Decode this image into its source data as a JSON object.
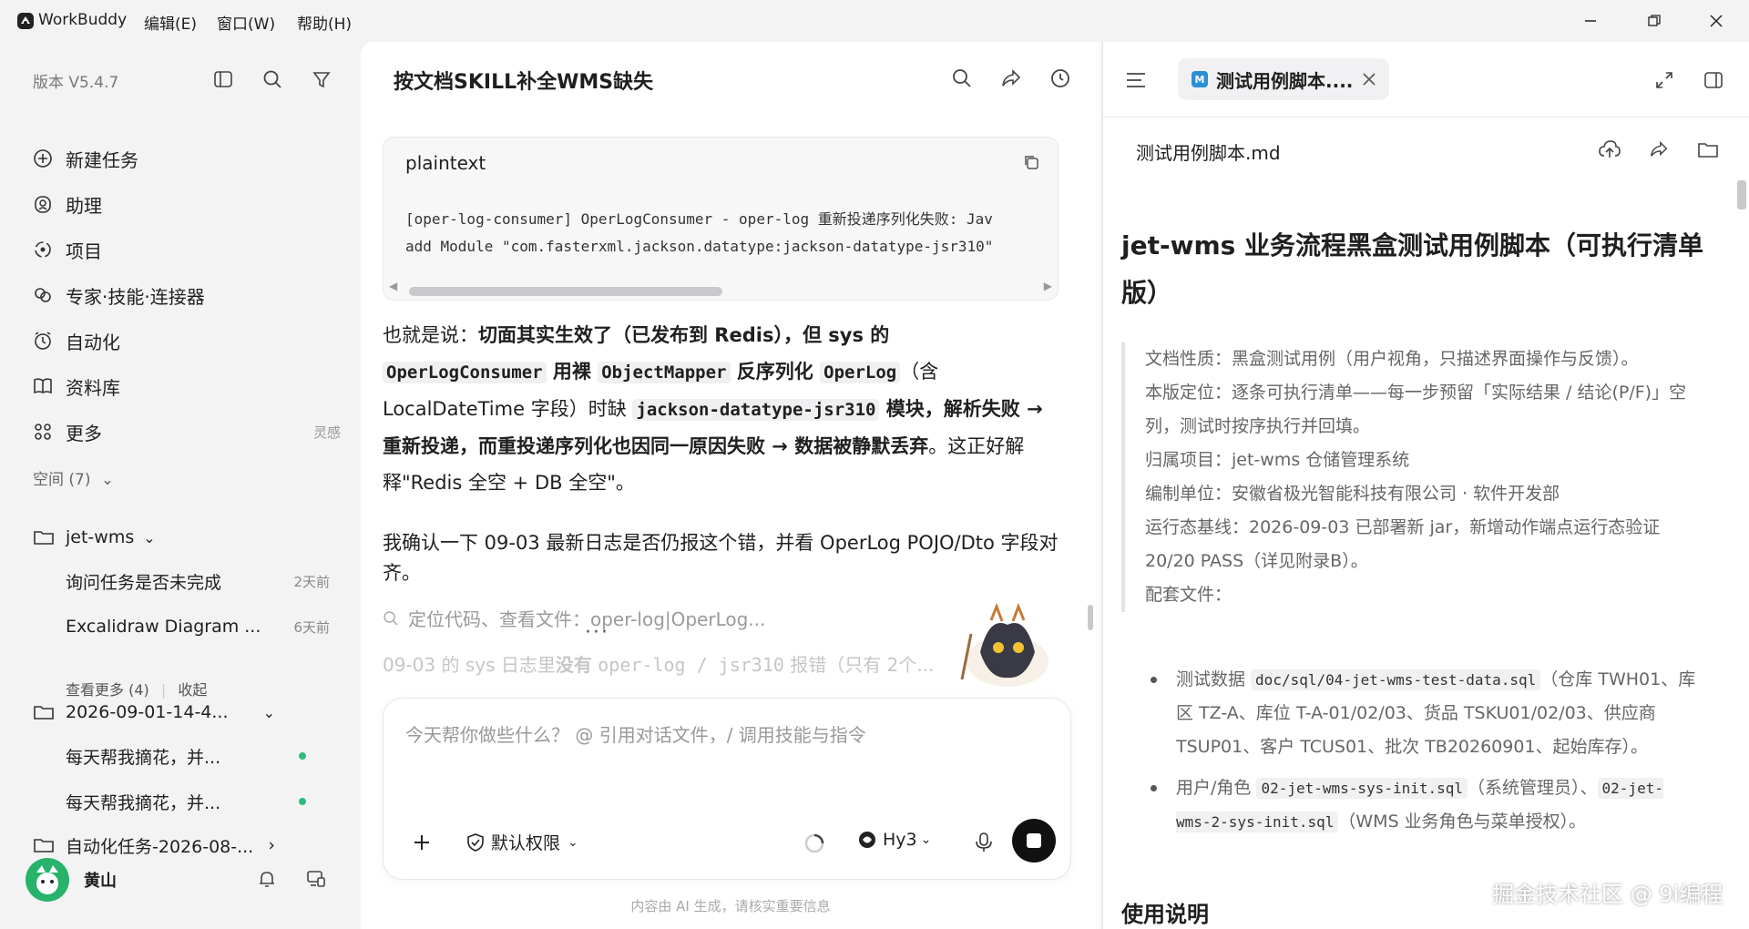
{
  "app": {
    "name": "WorkBuddy",
    "menus": [
      "编辑(E)",
      "窗口(W)",
      "帮助(H)"
    ]
  },
  "sidebar": {
    "version": "版本 V5.4.7",
    "nav": [
      {
        "label": "新建任务",
        "icon": "plus-circle-icon"
      },
      {
        "label": "助理",
        "icon": "assistant-icon"
      },
      {
        "label": "项目",
        "icon": "project-icon"
      },
      {
        "label": "专家·技能·连接器",
        "icon": "expert-icon"
      },
      {
        "label": "自动化",
        "icon": "automation-icon"
      },
      {
        "label": "资料库",
        "icon": "library-icon"
      },
      {
        "label": "更多",
        "icon": "more-icon",
        "extra": "灵感"
      }
    ],
    "space_label": "空间 (7)",
    "folders": [
      {
        "name": "jet-wms",
        "tasks": [
          {
            "title": "询问任务是否未完成",
            "time": "2天前"
          },
          {
            "title": "Excalidraw Diagram ...",
            "time": "6天前"
          }
        ]
      },
      {
        "name": "2026-09-01-14-4...",
        "tasks": [
          {
            "title": "每天帮我摘花，并..."
          },
          {
            "title": "每天帮我摘花，并..."
          }
        ]
      },
      {
        "name": "自动化任务-2026-08-..."
      }
    ],
    "see_more": "查看更多 (4)",
    "collapse": "收起",
    "user_name": "黄山"
  },
  "chat": {
    "title": "按文档SKILL补全WMS缺失",
    "code": {
      "lang": "plaintext",
      "line1": "[oper-log-consumer] OperLogConsumer - oper-log 重新投递序列化失败: Jav",
      "line2": "add Module \"com.fasterxml.jackson.datatype:jackson-datatype-jsr310\""
    },
    "para1": {
      "a": "也就是说：",
      "b": "切面其实生效了（已发布到 Redis），但 sys 的",
      "c1": "OperLogConsumer",
      "c2": " 用裸 ",
      "c3": "ObjectMapper",
      "c4": " 反序列化 ",
      "c5": "OperLog",
      "c6": "（含 LocalDateTime 字段）时缺 ",
      "c7": "jackson-datatype-jsr310",
      "c8": " 模块，解析失败 → 重新投递，而重投递序列化也因同一原因失败 → 数据被静默丢弃",
      "d": "。这正好解释\"Redis 全空 + DB 全空\"。"
    },
    "para2": "我确认一下 09-03 最新日志是否仍报这个错，并看 OperLog POJO/Dto 字段对齐。",
    "search_action": "定位代码、查看文件：oper-log|OperLog...",
    "faded": {
      "a": "09-03 的 sys 日志里",
      "b": "没有",
      "c": "oper-log / jsr310",
      "d": " 报错（只有 2个..."
    },
    "input_placeholder": "今天帮你做些什么？ @ 引用对话文件，/ 调用技能与指令",
    "permission": "默认权限",
    "model": "Hy3",
    "footer": "内容由 AI 生成，请核实重要信息"
  },
  "doc": {
    "tab": "测试用例脚本....",
    "file_name": "测试用例脚本.md",
    "title": "jet-wms 业务流程黑盒测试用例脚本（可执行清单版）",
    "meta": [
      "文档性质：黑盒测试用例（用户视角，只描述界面操作与反馈）。",
      "本版定位：逐条可执行清单——每一步预留「实际结果 / 结论(P/F)」空列，测试时按序执行并回填。",
      "归属项目：jet-wms 仓储管理系统",
      "编制单位：安徽省极光智能科技有限公司 · 软件开发部",
      "运行态基线：2026-09-03 已部署新 jar，新增动作端点运行态验证 20/20 PASS（详见附录B）。",
      "配套文件："
    ],
    "bullet1": {
      "a": "测试数据 ",
      "code": "doc/sql/04-jet-wms-test-data.sql",
      "b": "（仓库 TWH01、库区 TZ-A、库位 T-A-01/02/03、货品 TSKU01/02/03、供应商 TSUP01、客户 TCUS01、批次 TB20260901、起始库存）。"
    },
    "bullet2": {
      "a": "用户/角色 ",
      "code1": "02-jet-wms-sys-init.sql",
      "b": "（系统管理员）、",
      "code2": "02-jet-wms-2-sys-init.sql",
      "c": "（WMS 业务角色与菜单授权）。"
    },
    "usage_heading": "使用说明"
  },
  "watermark": "掘金技术社区 @ 9i编程"
}
